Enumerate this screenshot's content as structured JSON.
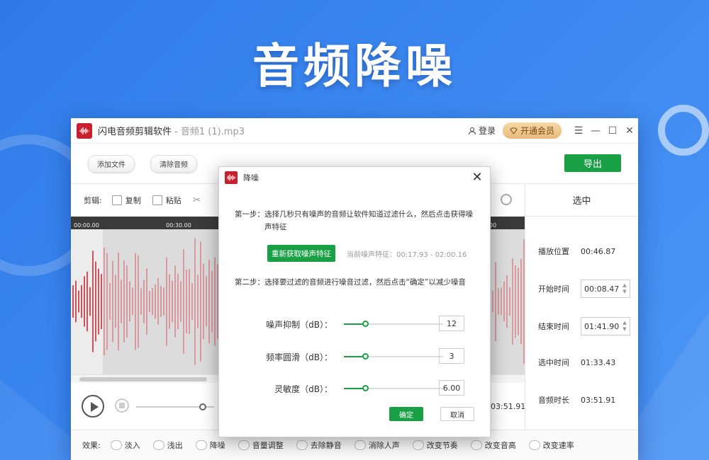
{
  "hero": {
    "title": "音频降噪"
  },
  "app": {
    "title": "闪电音频剪辑软件",
    "file": "- 音频1 (1).mp3",
    "login": "登录",
    "vip": "开通会员"
  },
  "toolbar": {
    "add_file": "添加文件",
    "clear_audio": "清除音频",
    "export": "导出"
  },
  "editbar": {
    "label": "剪辑:",
    "copy": "复制",
    "paste": "粘贴"
  },
  "timeline": {
    "ticks": [
      "00:00.00",
      "00:30.00",
      "00"
    ]
  },
  "player": {
    "time": "03:51.91"
  },
  "right_panel": {
    "header": "选中",
    "play_position_label": "播放位置",
    "play_position": "00:46.87",
    "start_label": "开始时间",
    "start": "00:08.47",
    "end_label": "结束时间",
    "end": "01:41.90",
    "selected_label": "选中时间",
    "selected": "01:33.43",
    "duration_label": "音频时长",
    "duration": "03:51.91"
  },
  "effects": {
    "label": "效果:",
    "items": [
      "淡入",
      "浅出",
      "降噪",
      "音量调整",
      "去除静音",
      "消除人声",
      "改变节奏",
      "改变音高",
      "改变速率"
    ]
  },
  "dialog": {
    "title": "降噪",
    "step1_label": "第一步：",
    "step1_text": "选择几秒只有噪声的音频让软件知道过滤什么，然后点击获得噪声特征",
    "refetch_button": "重新获取噪声特征",
    "feature_info": "当前噪声特征：00:17.93 - 02:00.16",
    "step2_label": "第二步：",
    "step2_text": "选择要过滤的音频进行噪音过滤，然后点击“确定”以减少噪音",
    "sliders": [
      {
        "label": "噪声抑制（dB）：",
        "value": "12"
      },
      {
        "label": "频率圆滑（dB）：",
        "value": "3"
      },
      {
        "label": "灵敏度（dB）：",
        "value": "6.00"
      }
    ],
    "ok": "确定",
    "cancel": "取消"
  },
  "colors": {
    "accent_green": "#19a045",
    "brand_red": "#c8202e",
    "waveform_red": "#c62b35",
    "background_blue": "#3b87f0"
  },
  "icons": [
    "waveform-logo-icon",
    "user-icon",
    "diamond-icon",
    "menu-icon",
    "minimize-icon",
    "maximize-icon",
    "close-icon",
    "copy-icon",
    "paste-icon",
    "scissors-icon",
    "zoom-icon",
    "play-icon",
    "stop-icon"
  ]
}
